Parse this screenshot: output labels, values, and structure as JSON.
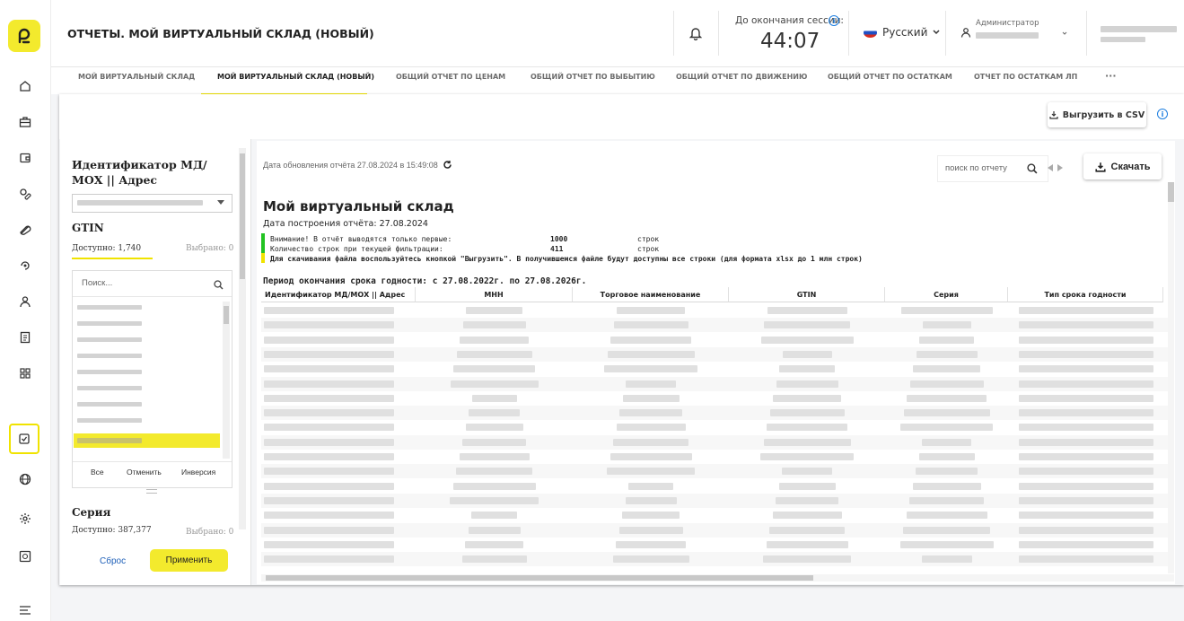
{
  "header": {
    "title": "ОТЧЕТЫ. МОЙ ВИРТУАЛЬНЫЙ СКЛАД (НОВЫЙ)",
    "session_label": "До окончания сессии:",
    "session_time": "44:07",
    "language": "Русский",
    "user_role": "Администратор"
  },
  "tabs": [
    "МОЙ ВИРТУАЛЬНЫЙ СКЛАД",
    "МОЙ ВИРТУАЛЬНЫЙ СКЛАД (НОВЫЙ)",
    "ОБЩИЙ ОТЧЕТ ПО ЦЕНАМ",
    "ОБЩИЙ ОТЧЕТ ПО ВЫБЫТИЮ",
    "ОБЩИЙ ОТЧЕТ ПО ДВИЖЕНИЮ",
    "ОБЩИЙ ОТЧЕТ ПО ОСТАТКАМ",
    "ОТЧЕТ ПО ОСТАТКАМ ЛП",
    "···"
  ],
  "toolbar": {
    "export_csv": "Выгрузить в CSV"
  },
  "filter": {
    "field_title": "Идентификатор МД/МОХ || Адрес",
    "gtin": {
      "title": "GTIN",
      "available": "Доступно: 1,740",
      "selected": "Выбрано: 0",
      "search_placeholder": "Поиск...",
      "btn_all": "Все",
      "btn_cancel": "Отменить",
      "btn_invert": "Инверсия"
    },
    "series": {
      "title": "Серия",
      "available": "Доступно: 387,377",
      "selected": "Выбрано: 0"
    },
    "reset": "Сброс",
    "apply": "Применить"
  },
  "report": {
    "updated": "Дата обновления отчёта 27.08.2024 в 15:49:08",
    "search_placeholder": "поиск по отчету",
    "download": "Скачать",
    "title": "Мой виртуальный склад",
    "build_date": "Дата построения отчёта: 27.08.2024",
    "warn_label": "Внимание! В отчёт выводятся только первые:",
    "warn_value": "1000",
    "warn_unit": "строк",
    "count_label": "Количество строк при текущей фильтрации:",
    "count_value": "411",
    "count_unit": "строк",
    "download_note": "Для скачивания файла воспользуйтесь кнопкой \"Выгрузить\". В получившемся файле будут доступны все строки (для формата xlsx до 1 млн строк)",
    "period": "Период окончания срока годности: с 27.08.2022г. по 27.08.2026г.",
    "columns": [
      "Идентификатор МД/МОХ || Адрес",
      "МНН",
      "Торговое наименование",
      "GTIN",
      "Серия",
      "Тип срока годности"
    ]
  },
  "colors": {
    "accent": "#f3ea2d",
    "link": "#1d5fb8",
    "info": "#1d7ee0",
    "ok_bar": "#22c322",
    "note_bar": "#f0e300"
  },
  "icons": [
    "logo-icon",
    "home-icon",
    "briefcase-icon",
    "wallet-icon",
    "pills-icon",
    "capsule-icon",
    "cycle-icon",
    "user-icon",
    "document-icon",
    "grid-icon",
    "checkbox-icon",
    "globe-icon",
    "gear-icon",
    "video-icon",
    "menu-icon",
    "bell-icon",
    "refresh-icon",
    "search-icon",
    "download-icon",
    "info-icon",
    "chevron-down-icon",
    "arrow-left-icon",
    "arrow-right-icon"
  ]
}
